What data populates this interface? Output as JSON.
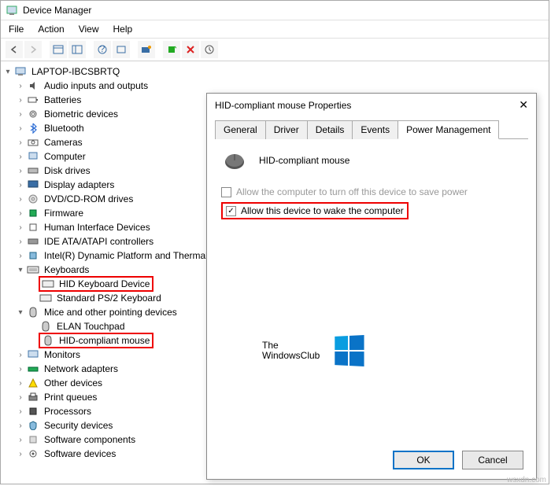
{
  "window": {
    "title": "Device Manager"
  },
  "menu": {
    "file": "File",
    "action": "Action",
    "view": "View",
    "help": "Help"
  },
  "root": "LAPTOP-IBCSBRTQ",
  "cats": {
    "audio": "Audio inputs and outputs",
    "batteries": "Batteries",
    "biometric": "Biometric devices",
    "bluetooth": "Bluetooth",
    "cameras": "Cameras",
    "computer": "Computer",
    "disk": "Disk drives",
    "display": "Display adapters",
    "dvd": "DVD/CD-ROM drives",
    "firmware": "Firmware",
    "hid": "Human Interface Devices",
    "ide": "IDE ATA/ATAPI controllers",
    "intel": "Intel(R) Dynamic Platform and Thermal Framework",
    "keyboards": "Keyboards",
    "hidkbd": "HID Keyboard Device",
    "ps2kbd": "Standard PS/2 Keyboard",
    "mice": "Mice and other pointing devices",
    "elan": "ELAN Touchpad",
    "hidmouse": "HID-compliant mouse",
    "monitors": "Monitors",
    "network": "Network adapters",
    "other": "Other devices",
    "printq": "Print queues",
    "processors": "Processors",
    "security": "Security devices",
    "swcomp": "Software components",
    "swdev": "Software devices"
  },
  "dialog": {
    "title": "HID-compliant mouse Properties",
    "tabs": {
      "general": "General",
      "driver": "Driver",
      "details": "Details",
      "events": "Events",
      "power": "Power Management"
    },
    "device_name": "HID-compliant mouse",
    "opt1": "Allow the computer to turn off this device to save power",
    "opt2": "Allow this device to wake the computer",
    "ok": "OK",
    "cancel": "Cancel"
  },
  "brand": {
    "l1": "The",
    "l2": "WindowsClub"
  },
  "watermark": "wsxdn.com"
}
